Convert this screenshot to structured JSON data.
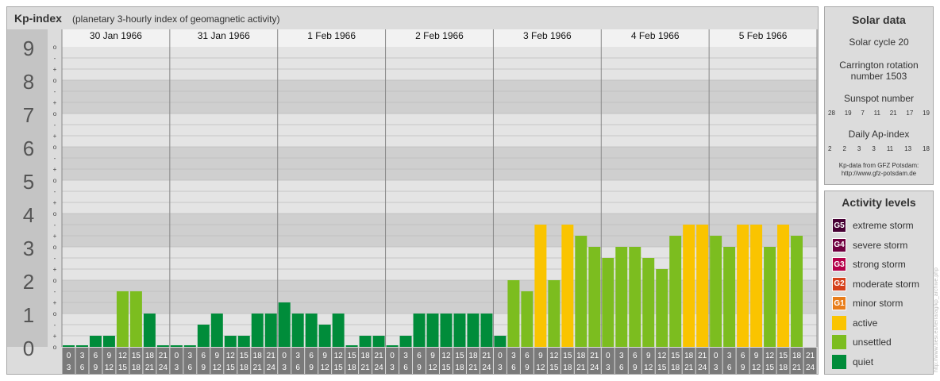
{
  "header": {
    "title": "Kp-index",
    "subtitle": "(planetary 3-hourly index of geomagnetic activity)"
  },
  "chart_data": {
    "type": "bar",
    "title": "Kp-index",
    "subtitle": "(planetary 3-hourly index of geomagnetic activity)",
    "y_axis": {
      "range": [
        0,
        9
      ],
      "major_labels": [
        "0",
        "1",
        "2",
        "3",
        "4",
        "5",
        "6",
        "7",
        "8",
        "9"
      ],
      "minor_labels": [
        "-",
        "o",
        "+"
      ]
    },
    "days": [
      "30 Jan 1966",
      "31 Jan 1966",
      "1 Feb 1966",
      "2 Feb 1966",
      "3 Feb 1966",
      "4 Feb 1966",
      "5 Feb 1966"
    ],
    "intervals": [
      [
        "0",
        "3"
      ],
      [
        "3",
        "6"
      ],
      [
        "6",
        "9"
      ],
      [
        "9",
        "12"
      ],
      [
        "12",
        "15"
      ],
      [
        "15",
        "18"
      ],
      [
        "18",
        "21"
      ],
      [
        "21",
        "24"
      ]
    ],
    "series": [
      {
        "values": [
          0.0,
          0.0,
          0.333,
          0.333,
          1.667,
          1.667,
          1.0,
          0.0,
          0.0,
          0.0,
          0.667,
          1.0,
          0.333,
          0.333,
          1.0,
          1.0,
          1.333,
          1.0,
          1.0,
          0.667,
          1.0,
          0.0,
          0.333,
          0.333,
          0.0,
          0.333,
          1.0,
          1.0,
          1.0,
          1.0,
          1.0,
          1.0,
          0.333,
          2.0,
          1.667,
          3.667,
          2.0,
          3.667,
          3.333,
          3.0,
          2.667,
          3.0,
          3.0,
          2.667,
          2.333,
          3.333,
          3.667,
          3.667,
          3.333,
          3.0,
          3.667,
          3.667,
          3.0,
          3.667,
          3.333
        ]
      }
    ],
    "thresholds": {
      "unsettled": 1.667,
      "active": 3.667,
      "g1": 4.667,
      "g2": 5.667,
      "g3": 6.667,
      "g4": 7.667,
      "g5": 8.667
    },
    "colors": {
      "quiet": "#008c3a",
      "unsettled": "#7cbd1f",
      "active": "#fac400",
      "minor": "#e87d1a",
      "moderate": "#d5401a",
      "strong": "#b5004a",
      "severe": "#700040",
      "extreme": "#470034"
    }
  },
  "solar_data": {
    "title": "Solar data",
    "solar_cycle": "Solar cycle 20",
    "carrington_line1": "Carrington rotation",
    "carrington_line2": "number 1503",
    "sunspot_label": "Sunspot number",
    "sunspot_values": [
      "28",
      "19",
      "7",
      "11",
      "21",
      "17",
      "19"
    ],
    "ap_label": "Daily Ap-index",
    "ap_values": [
      "2",
      "2",
      "3",
      "3",
      "11",
      "13",
      "18"
    ],
    "credit_line1": "Kp-data from GFZ Potsdam:",
    "credit_line2": "http://www.gfz-potsdam.de"
  },
  "activity_levels": {
    "title": "Activity levels",
    "items": [
      {
        "badge": "G5",
        "label": "extreme storm",
        "color": "#470034"
      },
      {
        "badge": "G4",
        "label": "severe storm",
        "color": "#700040"
      },
      {
        "badge": "G3",
        "label": "strong storm",
        "color": "#b5004a"
      },
      {
        "badge": "G2",
        "label": "moderate storm",
        "color": "#d5401a"
      },
      {
        "badge": "G1",
        "label": "minor storm",
        "color": "#e87d1a"
      },
      {
        "badge": "",
        "label": "active",
        "color": "#fac400"
      },
      {
        "badge": "",
        "label": "unsettled",
        "color": "#7cbd1f"
      },
      {
        "badge": "",
        "label": "quiet",
        "color": "#008c3a"
      }
    ]
  },
  "watermark": "http://www.tiesi.eu/terra/ag/kp_archive.php"
}
